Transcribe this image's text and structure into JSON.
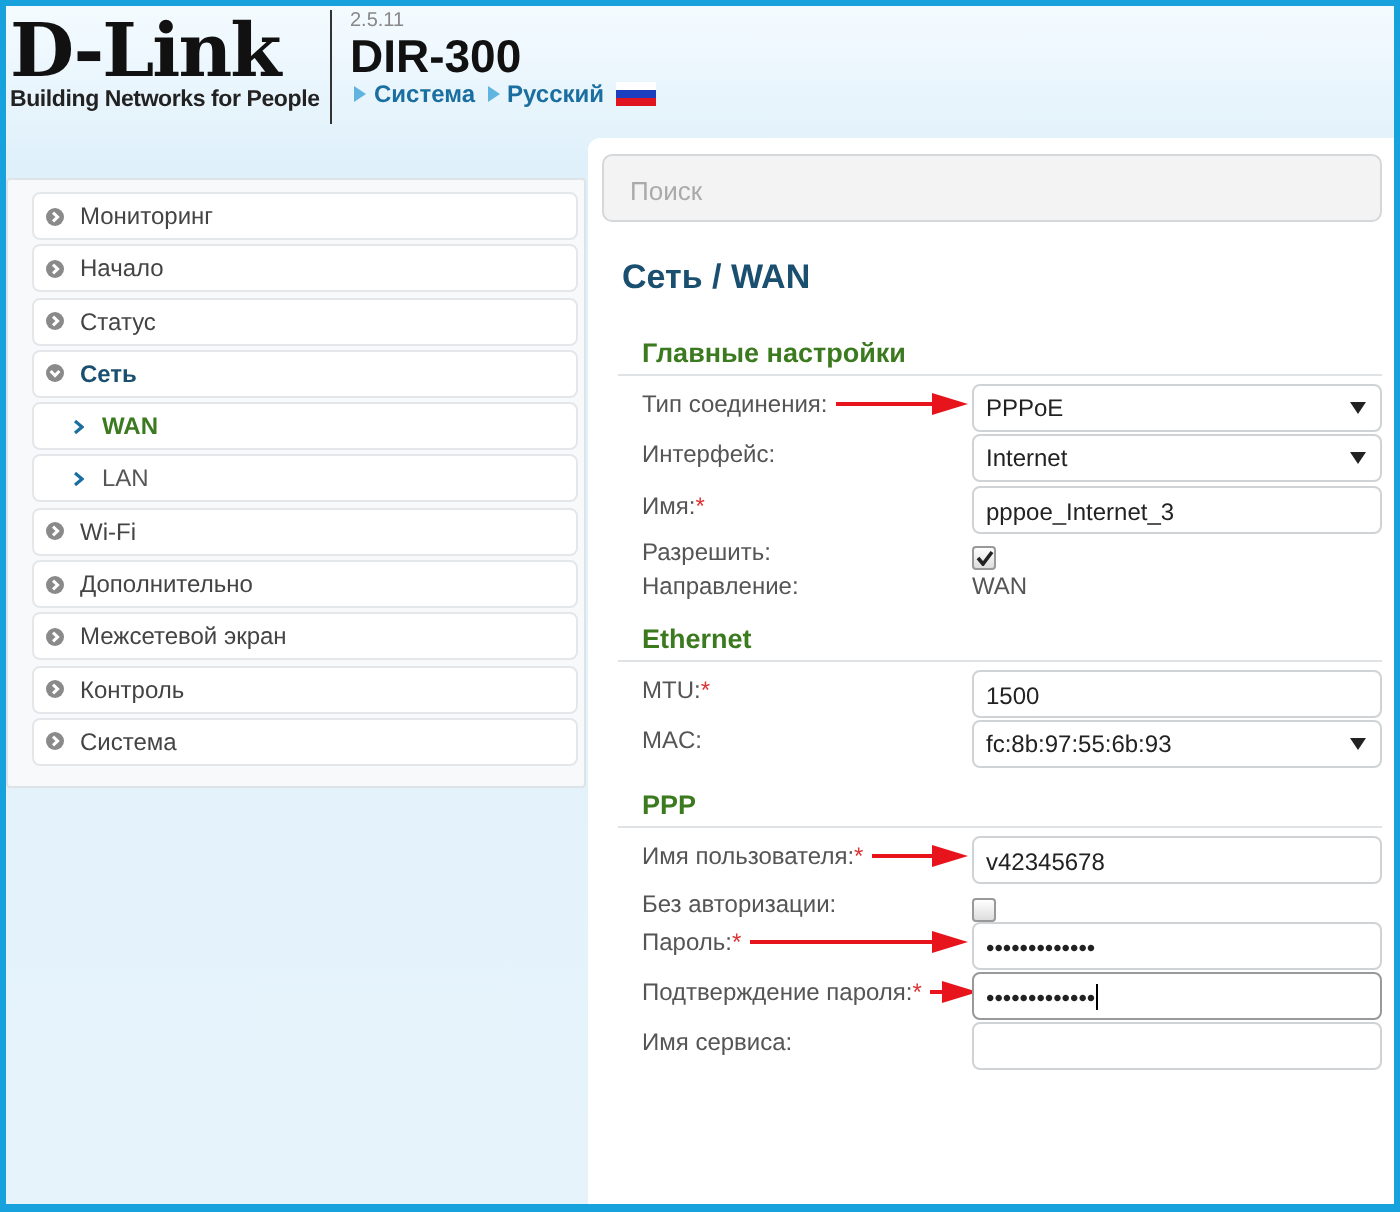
{
  "header": {
    "logo": "D-Link",
    "tagline": "Building Networks for People",
    "version": "2.5.11",
    "model": "DIR-300",
    "breadcrumbs": [
      "Система",
      "Русский"
    ]
  },
  "sidebar": {
    "items": [
      {
        "label": "Мониторинг",
        "expanded": false
      },
      {
        "label": "Начало",
        "expanded": false
      },
      {
        "label": "Статус",
        "expanded": false
      },
      {
        "label": "Сеть",
        "expanded": true,
        "children": [
          {
            "label": "WAN",
            "selected": true
          },
          {
            "label": "LAN",
            "selected": false
          }
        ]
      },
      {
        "label": "Wi-Fi",
        "expanded": false
      },
      {
        "label": "Дополнительно",
        "expanded": false
      },
      {
        "label": "Межсетевой экран",
        "expanded": false
      },
      {
        "label": "Контроль",
        "expanded": false
      },
      {
        "label": "Система",
        "expanded": false
      }
    ]
  },
  "search": {
    "placeholder": "Поиск"
  },
  "page_title": "Сеть /  WAN",
  "sections": [
    {
      "title": "Главные настройки",
      "rows": [
        {
          "kind": "select",
          "label": "Тип соединения:",
          "value": "PPPoE",
          "arrow": true
        },
        {
          "kind": "select",
          "label": "Интерфейс:",
          "value": "Internet",
          "arrow": false
        },
        {
          "kind": "text",
          "label": "Имя:",
          "required_mark": "*",
          "value": "pppoe_Internet_3",
          "arrow": false
        },
        {
          "kind": "checkbox",
          "label": "Разрешить:",
          "checked": true,
          "arrow": false
        },
        {
          "kind": "static",
          "label": "Направление:",
          "value": "WAN",
          "arrow": false
        }
      ]
    },
    {
      "title": "Ethernet",
      "rows": [
        {
          "kind": "text",
          "label": "MTU:",
          "required_mark": "*",
          "value": "1500",
          "arrow": false
        },
        {
          "kind": "select",
          "label": "MAC:",
          "value": "fc:8b:97:55:6b:93",
          "arrow": false
        }
      ]
    },
    {
      "title": "PPP",
      "rows": [
        {
          "kind": "text",
          "label": "Имя пользователя:",
          "required_mark": "*",
          "value": "v42345678",
          "arrow": true
        },
        {
          "kind": "checkbox",
          "label": "Без авторизации:",
          "checked": false,
          "arrow": false
        },
        {
          "kind": "text",
          "label": "Пароль:",
          "required_mark": "*",
          "value": "•••••••••••••",
          "arrow": true
        },
        {
          "kind": "text",
          "label": "Подтверждение пароля:",
          "required_mark": "*",
          "value": "•••••••••••••",
          "arrow": true,
          "focused": true
        },
        {
          "kind": "text",
          "label": "Имя сервиса:",
          "arrow": false
        }
      ]
    }
  ]
}
